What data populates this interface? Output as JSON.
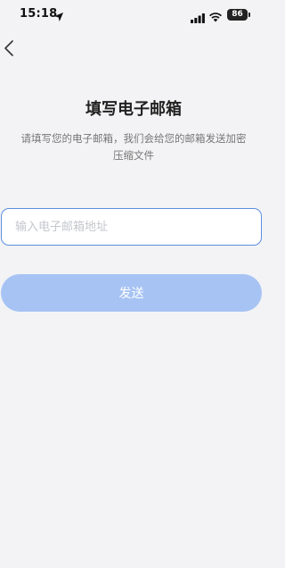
{
  "status_bar": {
    "time": "15:18",
    "battery": "86"
  },
  "header": {
    "title": "填写电子邮箱",
    "subtitle": "请填写您的电子邮箱，我们会给您的邮箱发送加密压缩文件"
  },
  "form": {
    "email_value": "",
    "email_placeholder": "输入电子邮箱地址",
    "send_label": "发送"
  },
  "colors": {
    "accent": "#5b8fe0",
    "button_disabled": "#a7c3f4",
    "background": "#f3f3f5"
  },
  "icons": {
    "back": "chevron-left-icon",
    "location": "location-arrow-icon",
    "signal": "cellular-signal-icon",
    "wifi": "wifi-icon"
  }
}
